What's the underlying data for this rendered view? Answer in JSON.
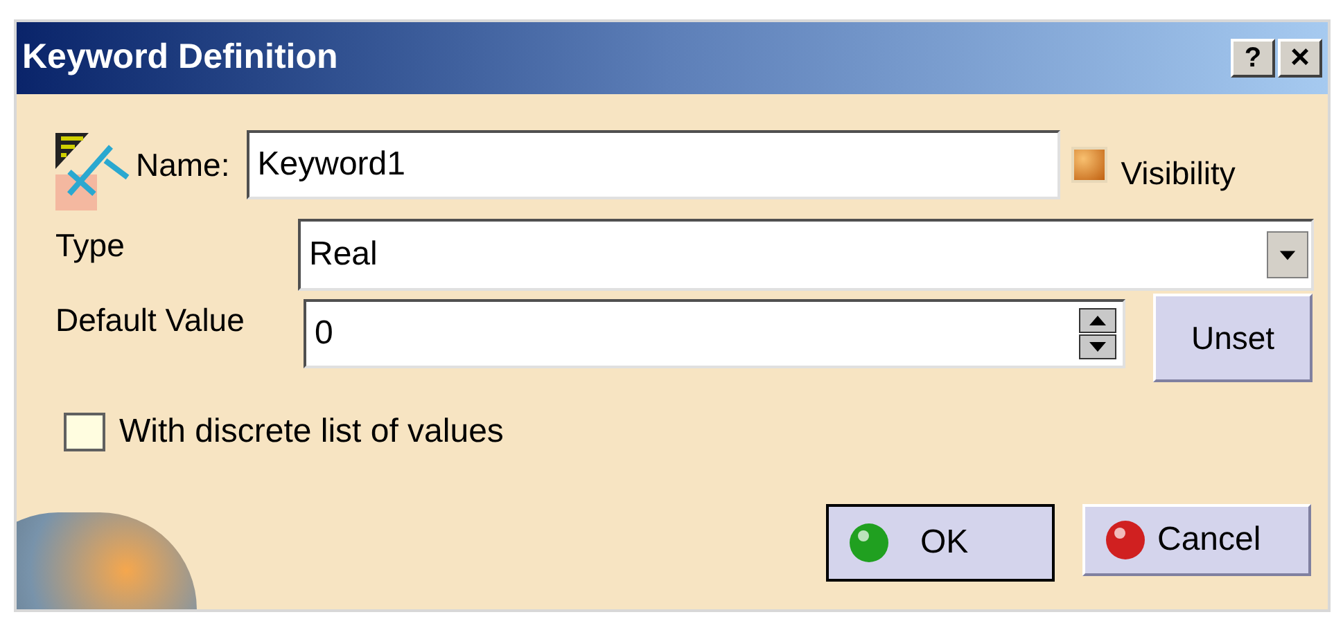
{
  "window": {
    "title": "Keyword Definition",
    "help_button": "?",
    "close_button": "×"
  },
  "name": {
    "label": "Name:",
    "value": "Keyword1"
  },
  "visibility": {
    "label": "Visibility",
    "checked": true
  },
  "type": {
    "label": "Type",
    "value": "Real"
  },
  "default_value": {
    "label": "Default Value",
    "value": "0"
  },
  "unset_button": "Unset",
  "discrete_list": {
    "label": "With discrete list of values",
    "checked": false
  },
  "buttons": [
    {
      "label": "OK",
      "kind": "ok"
    },
    {
      "label": "Cancel",
      "kind": "cancel"
    }
  ]
}
